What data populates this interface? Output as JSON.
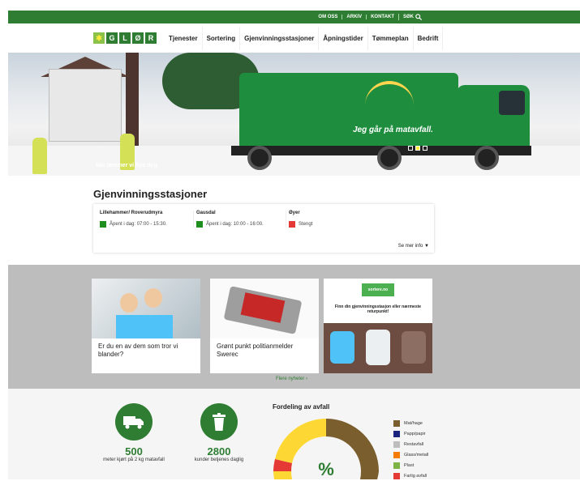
{
  "topbar": {
    "links": [
      "OM OSS",
      "ARKIV",
      "KONTAKT"
    ],
    "search": "SØK"
  },
  "logo": [
    "G",
    "L",
    "Ø",
    "R"
  ],
  "nav": [
    "Tjenester",
    "Sortering",
    "Gjenvinningsstasjoner",
    "Åpningstider",
    "Tømmeplan",
    "Bedrift"
  ],
  "hero": {
    "caption": "Når tømmer vi hos deg",
    "truck_text": "Jeg går på matavfall.",
    "slides": 3,
    "active_slide": 2
  },
  "recycle": {
    "title": "Gjenvinningsstasjoner",
    "stations": [
      {
        "name": "Lillehammer/ Roverudmyra",
        "status": "Åpent i dag: 07:00 - 15:30.",
        "color": "#1e8e1e"
      },
      {
        "name": "Gausdal",
        "status": "Åpent i dag: 10:00 - 16:00.",
        "color": "#1e8e1e"
      },
      {
        "name": "Øyer",
        "status": "Stengt",
        "color": "#e53935"
      }
    ],
    "more": "Se mer info"
  },
  "news": {
    "cards": [
      {
        "title": "Er du en av dem som tror vi blander?"
      },
      {
        "title": "Grønt punkt politianmelder Swerec"
      },
      {
        "title": "",
        "brand": "sortere.no",
        "text": "Finn din gjenvinningsstasjon eller nærmeste returpunkt!"
      }
    ],
    "more": "Flere nyheter"
  },
  "stats": [
    {
      "num": "500",
      "label": "meter kjørt på 2 kg matavfall",
      "icon": "truck-icon"
    },
    {
      "num": "2800",
      "label": "kunder betjenes daglig",
      "icon": "bin-icon"
    }
  ],
  "fordeling": {
    "title": "Fordeling av avfall",
    "center": "%",
    "legend": [
      {
        "name": "Mat/hage",
        "color": "#7b5e2e"
      },
      {
        "name": "Papp/papir",
        "color": "#1a237e"
      },
      {
        "name": "Restavfall",
        "color": "#bdbdbd"
      },
      {
        "name": "Glass/metall",
        "color": "#f57c00"
      },
      {
        "name": "Plast",
        "color": "#7cb342"
      },
      {
        "name": "Farlig avfall",
        "color": "#e53935"
      }
    ]
  }
}
